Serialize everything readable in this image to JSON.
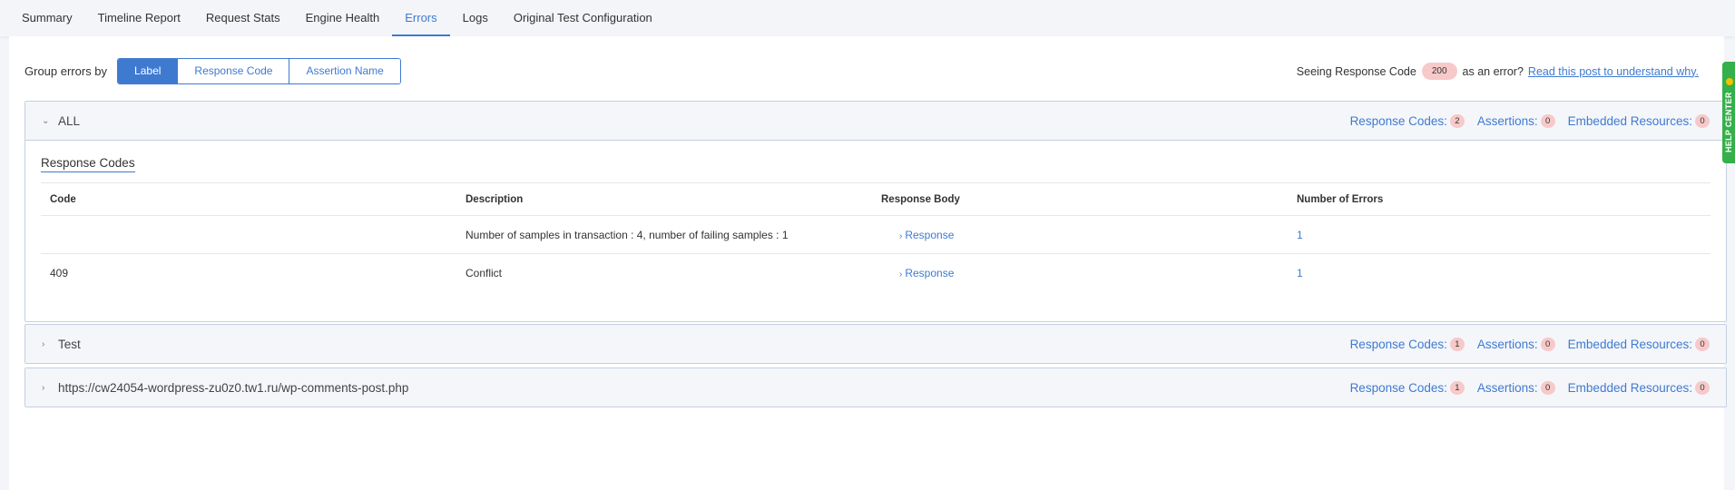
{
  "tabs": [
    {
      "label": "Summary",
      "active": false
    },
    {
      "label": "Timeline Report",
      "active": false
    },
    {
      "label": "Request Stats",
      "active": false
    },
    {
      "label": "Engine Health",
      "active": false
    },
    {
      "label": "Errors",
      "active": true
    },
    {
      "label": "Logs",
      "active": false
    },
    {
      "label": "Original Test Configuration",
      "active": false
    }
  ],
  "group_by": {
    "label": "Group errors by",
    "options": [
      "Label",
      "Response Code",
      "Assertion Name"
    ],
    "selected": "Label"
  },
  "seeing_notice": {
    "prefix": "Seeing Response Code",
    "code": "200",
    "suffix": "as an error?",
    "link": "Read this post to understand why."
  },
  "count_labels": {
    "response_codes": "Response Codes:",
    "assertions": "Assertions:",
    "embedded": "Embedded Resources:"
  },
  "sections": [
    {
      "title": "ALL",
      "expanded": true,
      "response_codes": "2",
      "assertions": "0",
      "embedded_resources": "0",
      "subheading": "Response Codes",
      "columns": [
        "Code",
        "Description",
        "Response Body",
        "Number of Errors"
      ],
      "rows": [
        {
          "code": "",
          "description": "Number of samples in transaction : 4, number of failing samples : 1",
          "response": "Response",
          "errors": "1"
        },
        {
          "code": "409",
          "description": "Conflict",
          "response": "Response",
          "errors": "1"
        }
      ]
    },
    {
      "title": "Test",
      "expanded": false,
      "response_codes": "1",
      "assertions": "0",
      "embedded_resources": "0"
    },
    {
      "title": "https://cw24054-wordpress-zu0z0.tw1.ru/wp-comments-post.php",
      "expanded": false,
      "response_codes": "1",
      "assertions": "0",
      "embedded_resources": "0"
    }
  ],
  "help_center": "HELP CENTER",
  "colors": {
    "accent": "#3f7ad1",
    "badge": "#f7c9c9",
    "help": "#35b04a"
  }
}
